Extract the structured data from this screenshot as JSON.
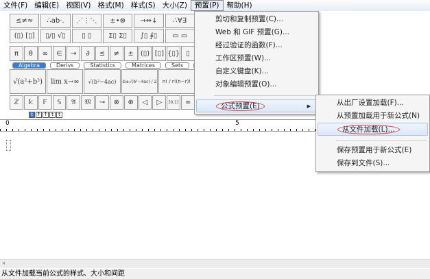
{
  "menubar": [
    "文件(F)",
    "编辑(E)",
    "视图(V)",
    "格式(M)",
    "样式(S)",
    "大小(Z)",
    "预置(P)",
    "帮助(H)"
  ],
  "toolbar": {
    "row1": [
      "≤≠≈",
      "∴ab·.",
      "⋰⋮⋱",
      "±•⊗",
      "→⇔↓",
      "∴∀∃"
    ],
    "row2": [
      "(▯) [▯]",
      "▯/▯ √▯",
      "▯ ▯",
      "Σ▯ Σ▯",
      "∫▯ ∮▯",
      "▭ ▭"
    ],
    "row3": [
      "π",
      "θ",
      "∞",
      "∈",
      "→",
      "∂",
      "≤",
      "≠",
      "±",
      "(▯)",
      "[▯]",
      "{▯}",
      "▯"
    ],
    "tabs": [
      "Algebra",
      "Derivs",
      "Statistics",
      "Matrices",
      "Sets",
      "T"
    ],
    "row4": [
      "√(a²+b²)",
      "lim x→∞",
      "√(b²−4ac)",
      "−b±√(b²−4ac) / 2a",
      "n! / r!(n−r)!"
    ],
    "row5": [
      "ℤ",
      "𝕜",
      "𝔽",
      "𝕊",
      "𝔄",
      "𝔐",
      "⊸",
      "⊗",
      "⊕",
      "◁",
      "▷",
      "[0,1]",
      "∞"
    ],
    "small": [
      "t",
      "↑",
      "↑",
      "t",
      "t"
    ]
  },
  "ruler": {
    "marks": [
      "0",
      "5"
    ]
  },
  "menu": {
    "items": [
      "剪切和复制预置(C)...",
      "Web 和 GIF 预置(G)...",
      "经过验证的函数(F)...",
      "工作区预置(W)...",
      "自定义键盘(K)...",
      "对象编辑预置(O)..."
    ],
    "submenu_label": "公式预置(E)"
  },
  "submenu": {
    "items": [
      "从出厂设置加载(F)...",
      "从预置加载用于新公式(N)",
      "从文件加载(L)..."
    ],
    "items2": [
      "保存预置用于新公式(E)",
      "保存到文件(S)..."
    ]
  },
  "status": "从文件加载当前公式的样式、大小和间距",
  "scroll_left": "◂"
}
